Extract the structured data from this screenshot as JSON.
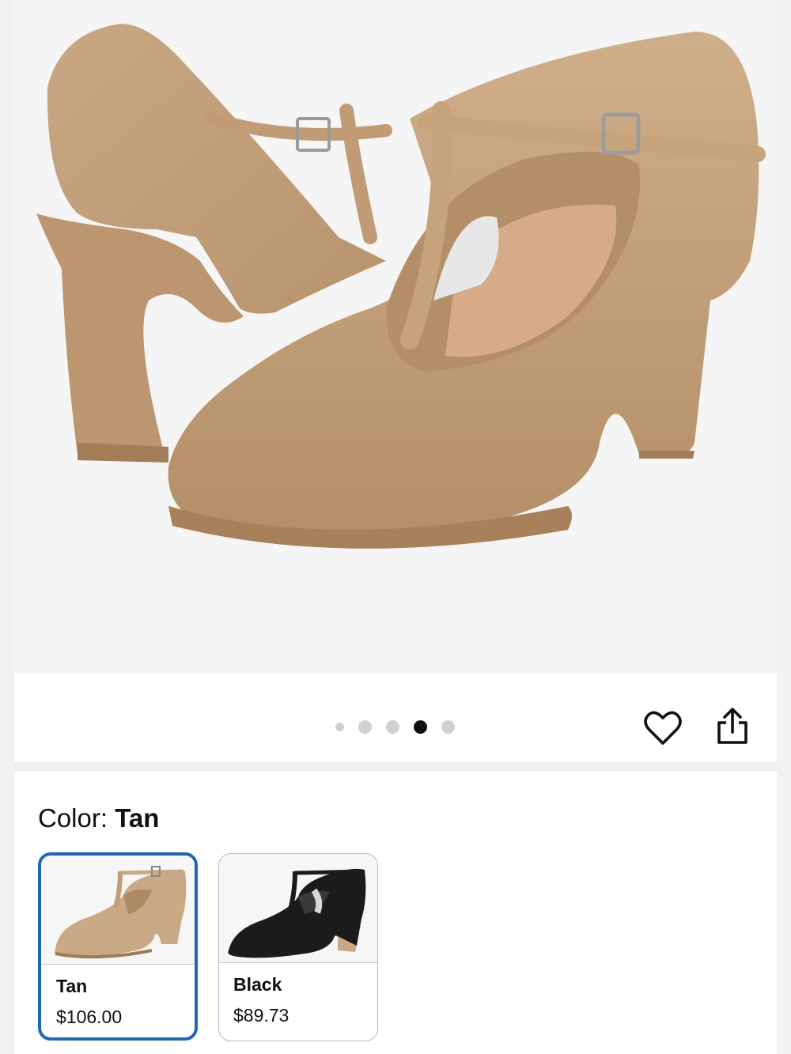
{
  "product": {
    "image_alt": "Tan leather T-strap character heel shoes",
    "carousel": {
      "count": 5,
      "active_index": 3
    }
  },
  "actions": {
    "favorite_icon": "heart-outline-icon",
    "share_icon": "share-icon"
  },
  "color_selector": {
    "label": "Color:",
    "selected": "Tan",
    "options": [
      {
        "name": "Tan",
        "price": "$106.00",
        "swatch_color": "#c9a886",
        "selected": true
      },
      {
        "name": "Black",
        "price": "$89.73",
        "swatch_color": "#1b1b1d",
        "selected": false
      }
    ]
  },
  "colors": {
    "selected_border": "#2067b1",
    "shoe_tan": "#c7a47f",
    "background": "#f5f5f6"
  }
}
